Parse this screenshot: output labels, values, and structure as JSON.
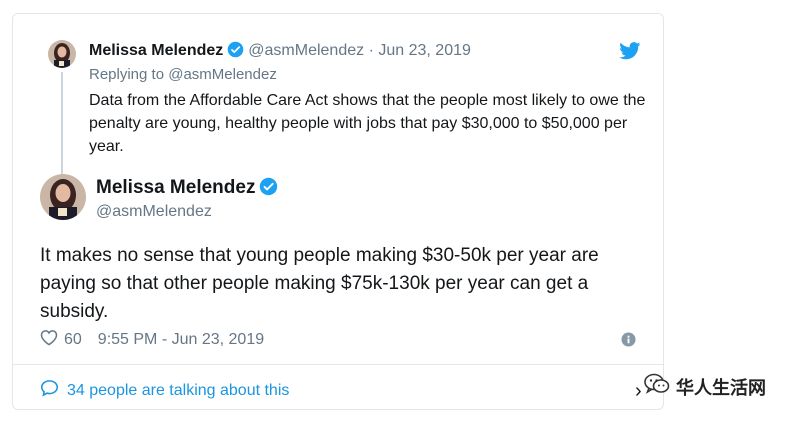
{
  "reply_tweet": {
    "name": "Melissa Melendez",
    "handle": "@asmMelendez",
    "separator": "·",
    "date": "Jun 23, 2019",
    "replying_to": "Replying to @asmMelendez",
    "text": "Data from the Affordable Care Act shows that the people most likely to owe the penalty are young, healthy people with jobs that pay $30,000 to $50,000 per year."
  },
  "main_tweet": {
    "name": "Melissa Melendez",
    "handle": "@asmMelendez",
    "text": "It makes no sense that young people making $30-50k per year are paying so that other people making $75k-130k per year can get a subsidy.",
    "likes": "60",
    "timestamp": "9:55 PM - Jun 23, 2019"
  },
  "footer": {
    "talking_label": "34 people are talking about this",
    "chevron": "›"
  },
  "watermark": {
    "text": "华人生活网"
  },
  "colors": {
    "link_blue": "#1b95e0",
    "verified_blue": "#1da1f2",
    "muted_gray": "#657786",
    "border": "#e1e8ed"
  },
  "icons": {
    "verified": "verified-badge-icon",
    "twitter": "twitter-bird-icon",
    "heart": "heart-icon",
    "info": "info-icon",
    "comment": "comment-bubble-icon"
  }
}
